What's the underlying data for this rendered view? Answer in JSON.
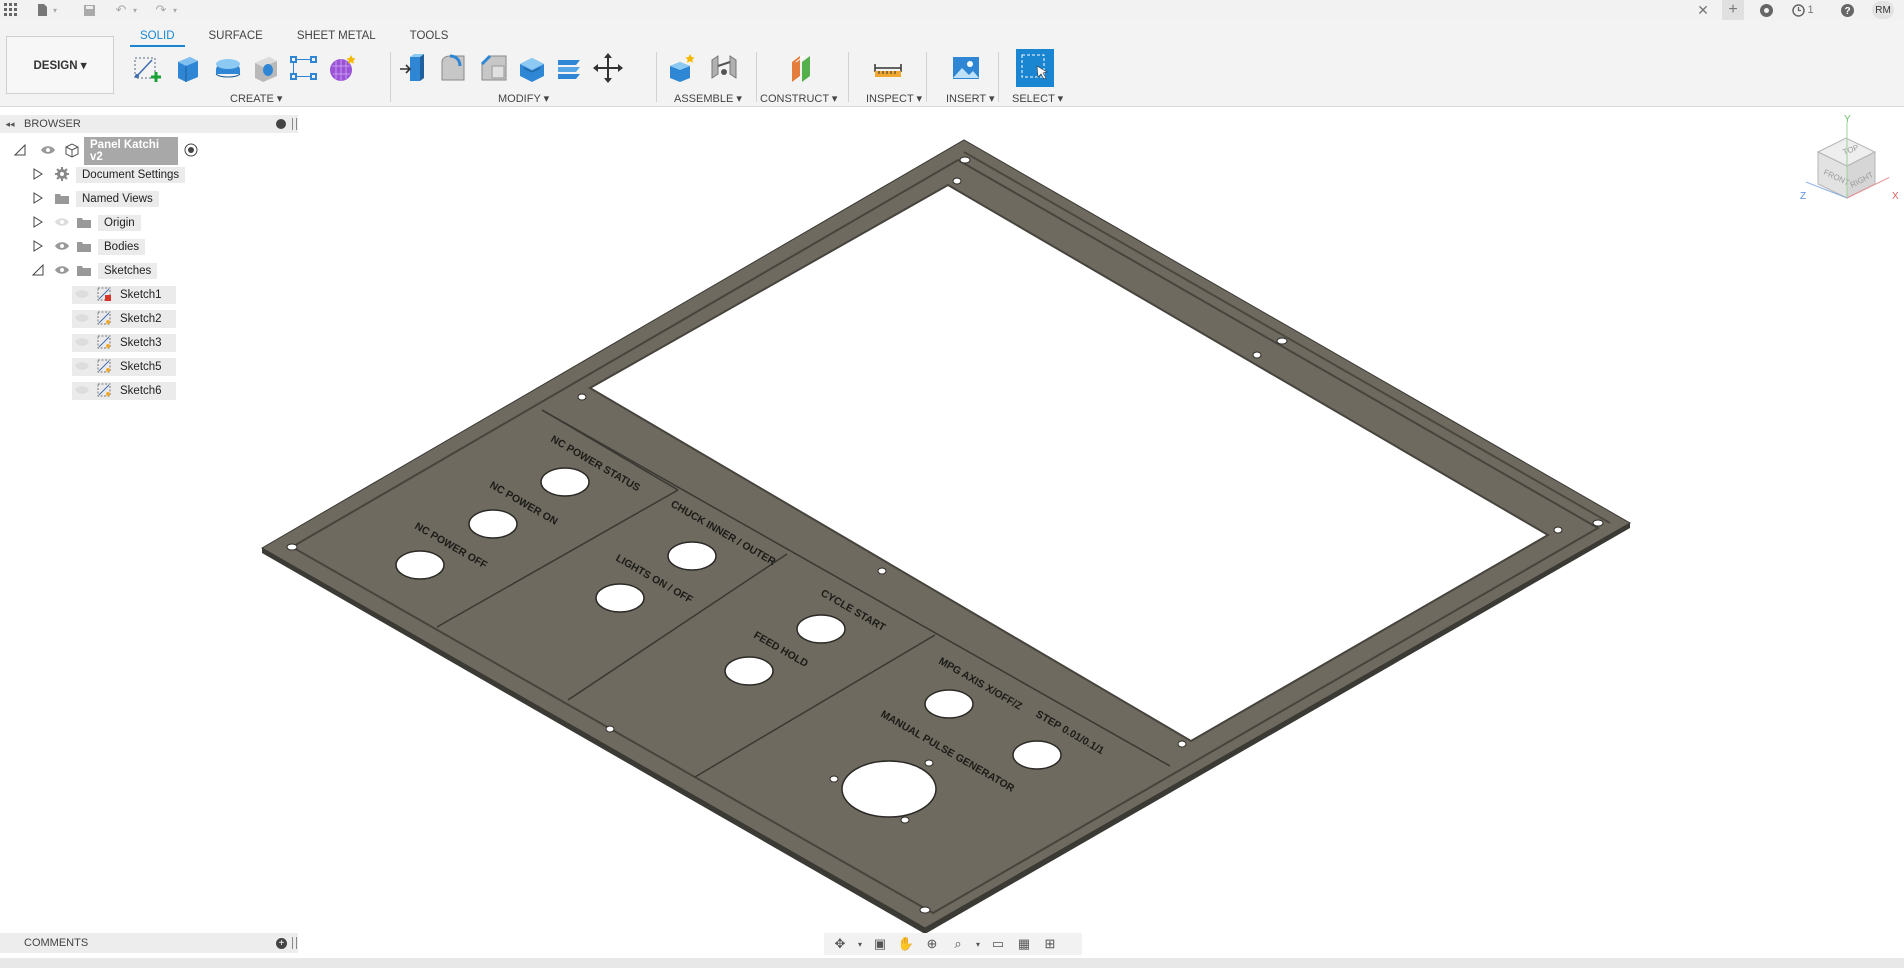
{
  "topbar": {
    "user_initials": "RM",
    "job_count": "1"
  },
  "ribbon": {
    "workspace": "DESIGN ▾",
    "tabs": [
      "SOLID",
      "SURFACE",
      "SHEET METAL",
      "TOOLS"
    ],
    "groups": {
      "create": "CREATE ▾",
      "modify": "MODIFY ▾",
      "assemble": "ASSEMBLE ▾",
      "construct": "CONSTRUCT ▾",
      "inspect": "INSPECT ▾",
      "insert": "INSERT ▾",
      "select": "SELECT ▾"
    }
  },
  "browser": {
    "title": "BROWSER",
    "root": "Panel Katchi v2",
    "items": [
      "Document Settings",
      "Named Views",
      "Origin",
      "Bodies",
      "Sketches"
    ],
    "sketches": [
      "Sketch1",
      "Sketch2",
      "Sketch3",
      "Sketch5",
      "Sketch6"
    ]
  },
  "comments": {
    "title": "COMMENTS"
  },
  "viewcube": {
    "top": "TOP",
    "front": "FRONT",
    "right": "RIGHT",
    "axis_x": "X",
    "axis_y": "Y",
    "axis_z": "Z"
  },
  "panel_labels": [
    "NC POWER STATUS",
    "NC POWER ON",
    "NC POWER OFF",
    "CHUCK INNER / OUTER",
    "LIGHTS ON / OFF",
    "CYCLE START",
    "FEED HOLD",
    "MPG AXIS X/OFF/Z",
    "STEP 0.01/0.1/1",
    "MANUAL PULSE GENERATOR"
  ],
  "colors": {
    "accent": "#1a86d1",
    "panel": "#6e6a5f",
    "panel_dark": "#4b4841"
  }
}
